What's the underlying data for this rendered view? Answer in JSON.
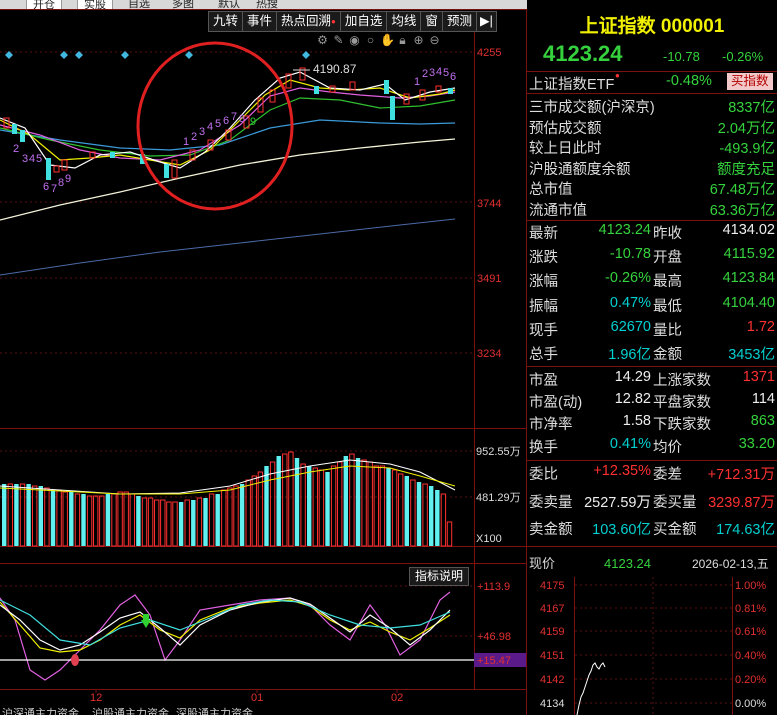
{
  "top_tabs": [
    "开仓",
    "实股",
    "自选",
    "多图",
    "默认",
    "热搜"
  ],
  "toolbar": {
    "buttons": [
      "九转",
      "事件",
      "热点回溯",
      "加自选",
      "均线",
      "窗",
      "预测"
    ],
    "icons": [
      "gear-icon",
      "pen-icon",
      "eye-icon",
      "circle-icon",
      "hand-icon",
      "lock-icon",
      "plus-icon",
      "minus-icon"
    ]
  },
  "main_chart": {
    "y_ticks": [
      "4255",
      "3744",
      "3491",
      "3234"
    ],
    "high_label": "4190.87",
    "nine_turn_down": [
      "2",
      "3",
      "4",
      "5",
      "6",
      "7",
      "8",
      "9"
    ],
    "nine_turn_up": [
      "1",
      "2",
      "3",
      "4",
      "5",
      "6",
      "7",
      "8",
      "9"
    ],
    "nine_turn_up2": [
      "1",
      "2",
      "3",
      "4",
      "5",
      "6"
    ]
  },
  "volume_chart": {
    "y_ticks": [
      "952.55万",
      "481.29万",
      "X100"
    ]
  },
  "indicator_chart": {
    "button": "指标说明",
    "y_ticks": [
      "+113.9",
      "+46.98",
      "+15.47"
    ],
    "x_ticks": [
      "12",
      "01",
      "02"
    ]
  },
  "bottom_tabs": [
    "沪深通主力资金",
    "沪股通主力资金",
    "深股通主力资金"
  ],
  "quote": {
    "title": "上证指数 000001",
    "price": "4123.24",
    "change": "-10.78",
    "pct": "-0.26%",
    "etf_label": "上证指数ETF",
    "etf_pct": "-0.48%",
    "etf_button": "买指数",
    "summary": [
      {
        "k": "三市成交额(沪深京)",
        "v": "8337亿",
        "c": "green"
      },
      {
        "k": "预估成交额",
        "v": "2.04万亿",
        "c": "cyan"
      },
      {
        "k": "较上日此时",
        "v": "-493.9亿",
        "c": "green"
      },
      {
        "k": "沪股通额度余额",
        "v": "额度充足",
        "c": "cyan"
      },
      {
        "k": "总市值",
        "v": "67.48万亿",
        "c": "cyan"
      },
      {
        "k": "流通市值",
        "v": "63.36万亿",
        "c": "cyan"
      }
    ],
    "grid1": [
      {
        "k1": "最新",
        "v1": "4123.24",
        "c1": "green",
        "k2": "昨收",
        "v2": "4134.02",
        "c2": "white"
      },
      {
        "k1": "涨跌",
        "v1": "-10.78",
        "c1": "green",
        "k2": "开盘",
        "v2": "4115.92",
        "c2": "green"
      },
      {
        "k1": "涨幅",
        "v1": "-0.26%",
        "c1": "green",
        "k2": "最高",
        "v2": "4123.84",
        "c2": "green"
      },
      {
        "k1": "振幅",
        "v1": "0.47%",
        "c1": "cyan",
        "k2": "最低",
        "v2": "4104.40",
        "c2": "green"
      },
      {
        "k1": "现手",
        "v1": "62670",
        "c1": "cyan",
        "k2": "量比",
        "v2": "1.72",
        "c2": "red"
      },
      {
        "k1": "总手",
        "v1": "1.96亿",
        "c1": "cyan",
        "k2": "金额",
        "v2": "3453亿",
        "c2": "cyan"
      }
    ],
    "grid2": [
      {
        "k1": "市盈",
        "v1": "14.29",
        "c1": "white",
        "k2": "上涨家数",
        "v2": "1371",
        "c2": "red"
      },
      {
        "k1": "市盈(动)",
        "v1": "12.82",
        "c1": "white",
        "k2": "平盘家数",
        "v2": "114",
        "c2": "white"
      },
      {
        "k1": "市净率",
        "v1": "1.58",
        "c1": "white",
        "k2": "下跌家数",
        "v2": "863",
        "c2": "green"
      },
      {
        "k1": "换手",
        "v1": "0.41%",
        "c1": "cyan",
        "k2": "均价",
        "v2": "33.20",
        "c2": "green"
      }
    ],
    "grid3": [
      {
        "k1": "委比",
        "v1": "+12.35%",
        "c1": "red",
        "k2": "委差",
        "v2": "+712.31万",
        "c2": "red"
      },
      {
        "k1": "委卖量",
        "v1": "2527.59万",
        "c1": "white",
        "k2": "委买量",
        "v2": "3239.87万",
        "c2": "red"
      },
      {
        "k1": "卖金额",
        "v1": "103.60亿",
        "c1": "cyan",
        "k2": "买金额",
        "v2": "174.63亿",
        "c2": "cyan"
      }
    ],
    "intraday": {
      "label": "现价",
      "price": "4123.24",
      "date": "2026-02-13,五",
      "left_ticks": [
        "4175",
        "4167",
        "4159",
        "4151",
        "4142",
        "4134"
      ],
      "right_ticks": [
        "1.00%",
        "0.81%",
        "0.61%",
        "0.40%",
        "0.20%",
        "0.00%"
      ]
    }
  }
}
